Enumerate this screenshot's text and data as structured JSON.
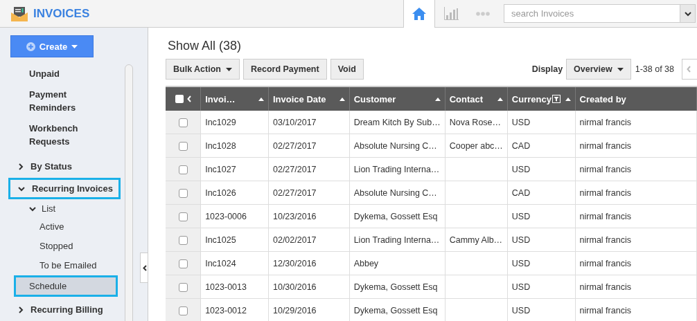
{
  "app": {
    "title": "INVOICES"
  },
  "nav": {
    "tabs": [
      {
        "kind": "home",
        "selected": true
      },
      {
        "kind": "chart",
        "selected": false
      },
      {
        "kind": "more",
        "selected": false
      }
    ],
    "search": {
      "placeholder": "search Invoices"
    }
  },
  "sidebar": {
    "create_button": "Create",
    "items": [
      {
        "label": "Unpaid"
      },
      {
        "label": "Payment Reminders"
      },
      {
        "label": "Workbench Requests"
      },
      {
        "label": "By Status",
        "expanded": false
      },
      {
        "label": "Recurring Invoices",
        "expanded": true,
        "highlighted": true,
        "children": [
          {
            "label": "List",
            "expanded": true,
            "children": [
              {
                "label": "Active",
                "selected": false
              },
              {
                "label": "Stopped",
                "selected": false
              },
              {
                "label": "To be Emailed",
                "selected": false
              }
            ]
          },
          {
            "label": "Schedule",
            "selected": true,
            "highlighted": true
          }
        ]
      },
      {
        "label": "Recurring Billing",
        "expanded": false
      }
    ]
  },
  "main": {
    "title": "Show All (38)",
    "actions": [
      {
        "label": "Bulk Action",
        "dropdown": true
      },
      {
        "label": "Record Payment",
        "dropdown": false
      },
      {
        "label": "Void",
        "dropdown": false
      }
    ],
    "display_label": "Display",
    "display_value": "Overview",
    "pager": "1-38 of 38",
    "table": {
      "columns": [
        {
          "label": "Invoi…",
          "sortable": true,
          "filtered": false
        },
        {
          "label": "Invoice Date",
          "sortable": true,
          "filtered": false
        },
        {
          "label": "Customer",
          "sortable": true,
          "filtered": false
        },
        {
          "label": "Contact",
          "sortable": true,
          "filtered": false
        },
        {
          "label": "Currency",
          "sortable": true,
          "filtered": true
        },
        {
          "label": "Created by",
          "sortable": false,
          "filtered": false
        }
      ],
      "select_all": false,
      "rows": [
        {
          "checked": false,
          "cells": [
            "Inc1029",
            "03/10/2017",
            "Dream Kitch By Sub…",
            "Nova Rose…",
            "USD",
            "nirmal francis"
          ]
        },
        {
          "checked": false,
          "cells": [
            "Inc1028",
            "02/27/2017",
            "Absolute Nursing C…",
            "Cooper abc…",
            "CAD",
            "nirmal francis"
          ]
        },
        {
          "checked": false,
          "cells": [
            "Inc1027",
            "02/27/2017",
            "Lion Trading Interna…",
            "",
            "USD",
            "nirmal francis"
          ]
        },
        {
          "checked": false,
          "cells": [
            "Inc1026",
            "02/27/2017",
            "Absolute Nursing C…",
            "",
            "CAD",
            "nirmal francis"
          ]
        },
        {
          "checked": false,
          "cells": [
            "1023-0006",
            "10/23/2016",
            "Dykema, Gossett Esq",
            "",
            "USD",
            "nirmal francis"
          ]
        },
        {
          "checked": false,
          "cells": [
            "Inc1025",
            "02/02/2017",
            "Lion Trading Interna…",
            "Cammy Alb…",
            "USD",
            "nirmal francis"
          ]
        },
        {
          "checked": false,
          "cells": [
            "Inc1024",
            "12/30/2016",
            "Abbey",
            "",
            "USD",
            "nirmal francis"
          ]
        },
        {
          "checked": false,
          "cells": [
            "1023-0013",
            "10/30/2016",
            "Dykema, Gossett Esq",
            "",
            "USD",
            "nirmal francis"
          ]
        },
        {
          "checked": false,
          "cells": [
            "1023-0012",
            "10/29/2016",
            "Dykema, Gossett Esq",
            "",
            "USD",
            "nirmal francis"
          ]
        }
      ]
    }
  }
}
